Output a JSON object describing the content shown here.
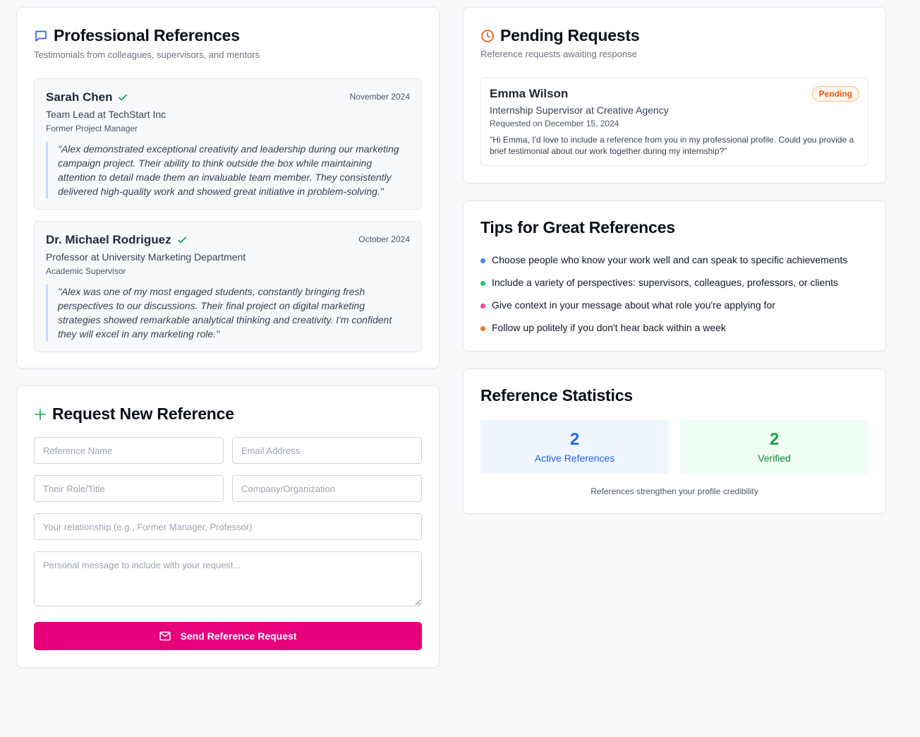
{
  "references_card": {
    "title": "Professional References",
    "subtitle": "Testimonials from colleagues, supervisors, and mentors",
    "items": [
      {
        "name": "Sarah Chen",
        "date": "November 2024",
        "role": "Team Lead at TechStart Inc",
        "relationship": "Former Project Manager",
        "quote": "\"Alex demonstrated exceptional creativity and leadership during our marketing campaign project. Their ability to think outside the box while maintaining attention to detail made them an invaluable team member. They consistently delivered high-quality work and showed great initiative in problem-solving.\""
      },
      {
        "name": "Dr. Michael Rodriguez",
        "date": "October 2024",
        "role": "Professor at University Marketing Department",
        "relationship": "Academic Supervisor",
        "quote": "\"Alex was one of my most engaged students, constantly bringing fresh perspectives to our discussions. Their final project on digital marketing strategies showed remarkable analytical thinking and creativity. I'm confident they will excel in any marketing role.\""
      }
    ]
  },
  "request_card": {
    "title": "Request New Reference",
    "fields": {
      "name_placeholder": "Reference Name",
      "email_placeholder": "Email Address",
      "role_placeholder": "Their Role/Title",
      "company_placeholder": "Company/Organization",
      "relationship_placeholder": "Your relationship (e.g., Former Manager, Professor)",
      "message_placeholder": "Personal message to include with your request..."
    },
    "send_label": "Send Reference Request"
  },
  "pending_card": {
    "title": "Pending Requests",
    "subtitle": "Reference requests awaiting response",
    "items": [
      {
        "name": "Emma Wilson",
        "badge": "Pending",
        "role": "Internship Supervisor at Creative Agency",
        "requested": "Requested on December 15, 2024",
        "message": "\"Hi Emma, I'd love to include a reference from you in my professional profile. Could you provide a brief testimonial about our work together during my internship?\""
      }
    ]
  },
  "tips_card": {
    "title": "Tips for Great References",
    "tips": [
      {
        "text": "Choose people who know your work well and can speak to specific achievements",
        "color": "#3b82f6"
      },
      {
        "text": "Include a variety of perspectives: supervisors, colleagues, professors, or clients",
        "color": "#22c55e"
      },
      {
        "text": "Give context in your message about what role you're applying for",
        "color": "#ec4899"
      },
      {
        "text": "Follow up politely if you don't hear back within a week",
        "color": "#f97316"
      }
    ]
  },
  "stats_card": {
    "title": "Reference Statistics",
    "active": {
      "value": "2",
      "label": "Active References",
      "color": "#2563eb",
      "bg": "#eff6ff"
    },
    "verified": {
      "value": "2",
      "label": "Verified",
      "color": "#16a34a",
      "bg": "#f0fdf4"
    },
    "footer": "References strengthen your profile credibility"
  },
  "colors": {
    "accent_pink": "#e6007a",
    "check_green": "#16a34a",
    "pending_orange": "#ea580c",
    "chat_icon_blue": "#2563eb"
  },
  "icons": {
    "references": "chat-bubble-icon",
    "pending": "clock-icon",
    "request": "plus-icon",
    "verified": "checkmark-icon",
    "send": "mail-icon"
  }
}
